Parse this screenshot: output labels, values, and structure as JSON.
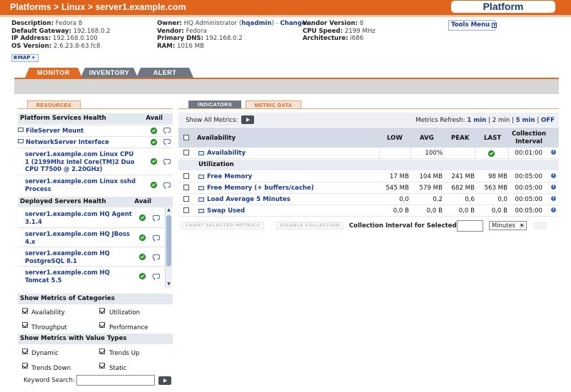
{
  "header": {
    "breadcrumb": [
      "Platforms",
      "Linux",
      "server1.example.com"
    ],
    "separator": ">",
    "platform_badge": "Platform"
  },
  "properties": {
    "col1": [
      {
        "label": "Description:",
        "value": "Fedora 8"
      },
      {
        "label": "Default Gateway:",
        "value": "192.168.0.2"
      },
      {
        "label": "IP Address:",
        "value": "192.168.0.100"
      },
      {
        "label": "OS Version:",
        "value": "2.6.23.8-63.fc8"
      }
    ],
    "col2": [
      {
        "label": "Owner:",
        "value": "HQ Administrator (",
        "owner_link": "hqadmin",
        "after": ") -",
        "change_link": "Change..."
      },
      {
        "label": "Vendor:",
        "value": "Fedora"
      },
      {
        "label": "Primary DNS:",
        "value": "192.168.0.2"
      },
      {
        "label": "RAM:",
        "value": "1016 MB"
      }
    ],
    "col3": [
      {
        "label": "Vendor Version:",
        "value": "8"
      },
      {
        "label": "CPU Speed:",
        "value": "2199 MHz"
      },
      {
        "label": "Architecture:",
        "value": "i686"
      }
    ]
  },
  "tools_menu": "Tools Menu",
  "map_button": "MAP",
  "main_tabs": [
    "MONITOR",
    "INVENTORY",
    "ALERT"
  ],
  "left_tab": "RESOURCES",
  "platform_services": {
    "title": "Platform Services Health",
    "avail_label": "Avail",
    "items": [
      {
        "name": "FileServer Mount",
        "folder": true,
        "available": true
      },
      {
        "name": "NetworkServer Interface",
        "folder": true,
        "available": true
      },
      {
        "name": "server1.example.com Linux CPU 1 (2199Mhz Intel Core(TM)2 Duo CPU T7500 @ 2.20GHz)",
        "folder": false,
        "available": true
      },
      {
        "name": "server1.example.com Linux sshd Process",
        "folder": false,
        "available": true
      }
    ]
  },
  "deployed_servers": {
    "title": "Deployed Servers Health",
    "avail_label": "Avail",
    "items": [
      {
        "name": "server1.example.com HQ Agent 3.1.4",
        "available": true
      },
      {
        "name": "server1.example.com HQ JBoss 4.x",
        "available": true
      },
      {
        "name": "server1.example.com HQ PostgreSQL 8.1",
        "available": true
      },
      {
        "name": "server1.example.com HQ Tomcat 5.5",
        "available": true
      }
    ]
  },
  "categories": {
    "title": "Show Metrics of Categories",
    "items": [
      {
        "label": "Availability",
        "checked": true
      },
      {
        "label": "Utilization",
        "checked": true
      },
      {
        "label": "Throughput",
        "checked": true
      },
      {
        "label": "Performance",
        "checked": true
      }
    ]
  },
  "value_types": {
    "title": "Show Metrics with Value Types",
    "items": [
      {
        "label": "Dynamic",
        "checked": true
      },
      {
        "label": "Trends Up",
        "checked": true
      },
      {
        "label": "Trends Down",
        "checked": true
      },
      {
        "label": "Static",
        "checked": true
      }
    ]
  },
  "keyword_search": {
    "label": "Keyword Search:",
    "value": ""
  },
  "right_tabs": [
    "INDICATORS",
    "METRIC DATA"
  ],
  "show_all_metrics": "Show All Metrics:",
  "metrics_refresh": {
    "label": "Metrics Refresh:",
    "options": [
      "1 min",
      "2 min",
      "5 min",
      "OFF"
    ],
    "separator": "|"
  },
  "metrics_table": {
    "headers": {
      "name": "Availability",
      "low": "LOW",
      "avg": "AVG",
      "peak": "PEAK",
      "last": "LAST",
      "interval": "Collection Interval"
    },
    "availability": {
      "name": "Availability",
      "low": "",
      "avg": "100%",
      "peak": "",
      "last_status": "ok",
      "interval": "00:01:00"
    },
    "utilization_title": "Utilization",
    "rows": [
      {
        "name": "Free Memory",
        "low": "17 MB",
        "avg": "104 MB",
        "peak": "241 MB",
        "last": "98 MB",
        "interval": "00:05:00"
      },
      {
        "name": "Free Memory (+ buffers/cache)",
        "low": "545 MB",
        "avg": "579 MB",
        "peak": "682 MB",
        "last": "563 MB",
        "interval": "00:05:00"
      },
      {
        "name": "Load Average 5 Minutes",
        "low": "0,0",
        "avg": "0,2",
        "peak": "0,6",
        "last": "0,0",
        "interval": "00:05:00"
      },
      {
        "name": "Swap Used",
        "low": "0,0 B",
        "avg": "0,0 B",
        "peak": "0,0 B",
        "last": "0,0 B",
        "interval": "00:05:00"
      }
    ]
  },
  "bottom_controls": {
    "chart_button": "CHART SELECTED METRICS",
    "disable_button": "DISABLE COLLECTION",
    "interval_label": "Collection Interval for Selected:",
    "interval_value": "",
    "unit_selected": "Minutes"
  },
  "colors": {
    "accent": "#e0641b",
    "link": "#1a3a8a",
    "header_bg": "#d4dbe6"
  }
}
